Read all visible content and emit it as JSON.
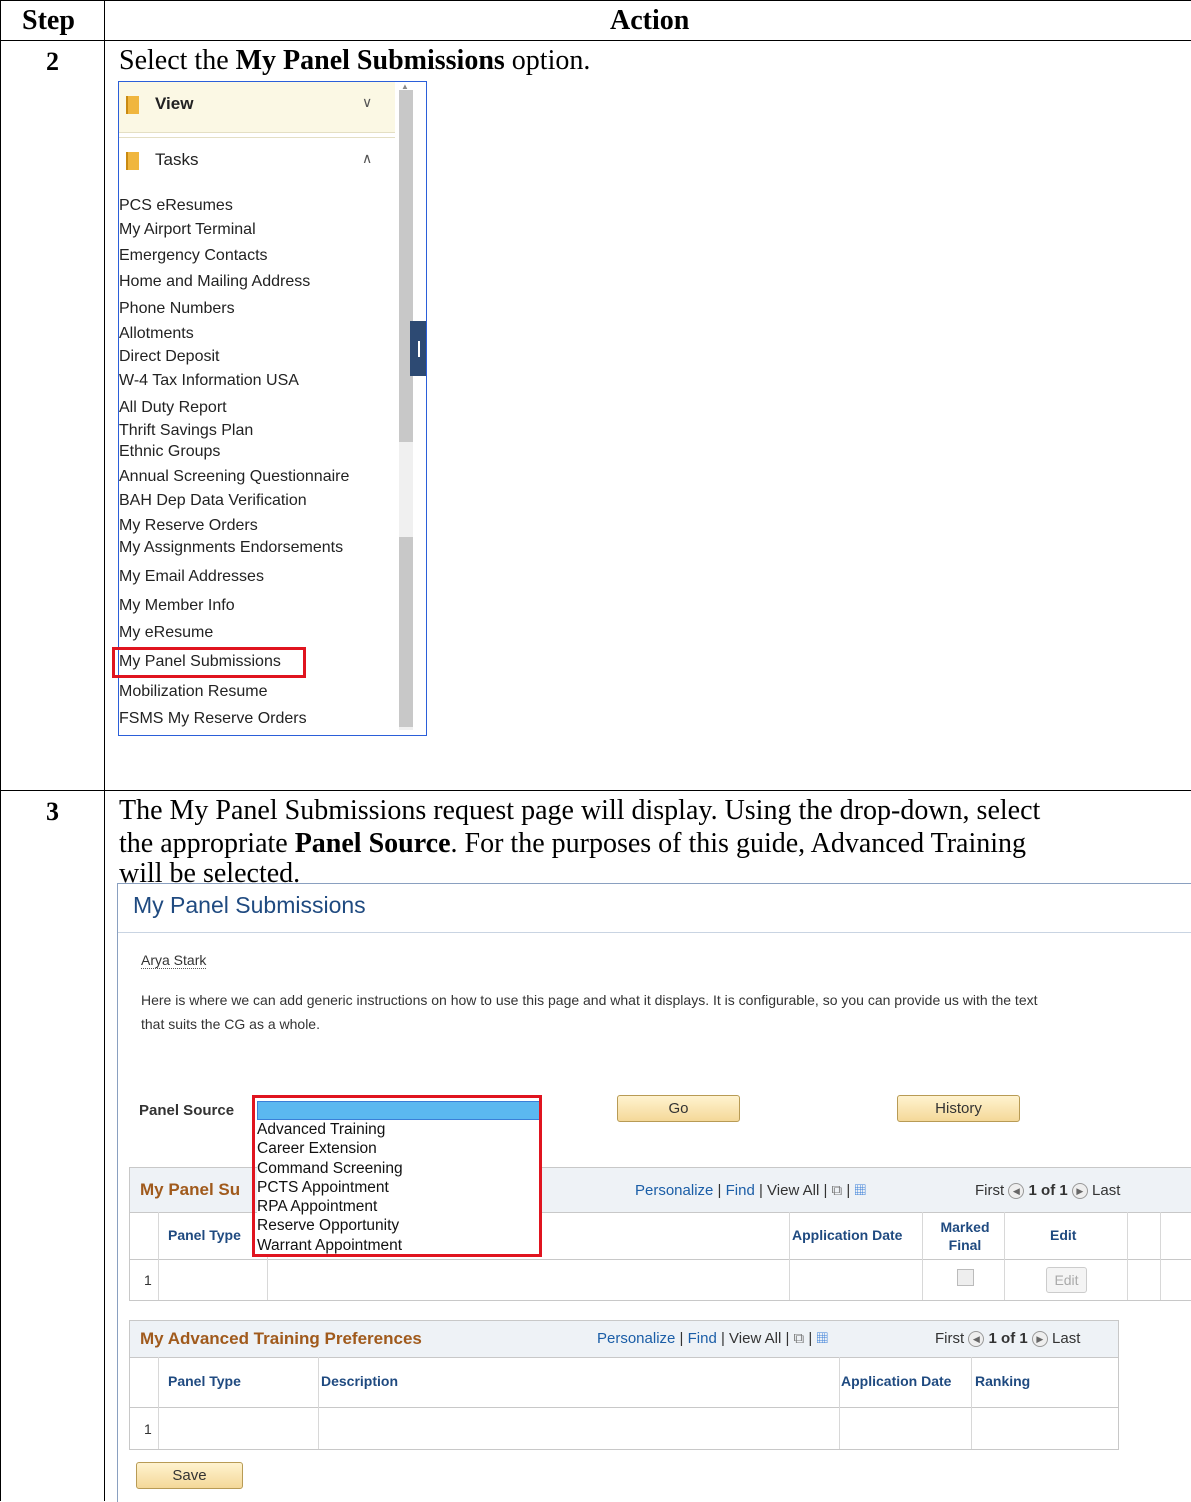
{
  "table": {
    "header_step": "Step",
    "header_action": "Action"
  },
  "row2": {
    "step": "2",
    "text_before": "Select the ",
    "text_bold": "My Panel Submissions",
    "text_after": " option."
  },
  "nav": {
    "sections": [
      "View",
      "Tasks"
    ],
    "items": [
      "PCS eResumes",
      "My Airport Terminal",
      "Emergency Contacts",
      "Home and Mailing Address",
      "Phone Numbers",
      "Allotments",
      "Direct Deposit",
      "W-4 Tax Information USA",
      "All Duty Report",
      "Thrift Savings Plan",
      "Ethnic Groups",
      "Annual Screening Questionnaire",
      "BAH Dep Data Verification",
      "My Reserve Orders",
      "My Assignments Endorsements",
      "My Email Addresses",
      "My Member Info",
      "My eResume",
      "My Panel Submissions",
      "Mobilization Resume",
      "FSMS My Reserve Orders"
    ]
  },
  "row3": {
    "step": "3",
    "line1": "The My Panel Submissions request page will display.  Using the drop-down, select",
    "line2_before": "the appropriate ",
    "line2_bold": "Panel Source",
    "line2_after": ".  For the purposes of this guide, Advanced Training",
    "line3": "will be selected."
  },
  "panel": {
    "title": "My Panel Submissions",
    "user_name": "Arya Stark",
    "instructions": "Here is where we can add generic instructions on how to use this page and what it displays. It is configurable, so you can provide us with the text that suits the CG as a whole.",
    "panel_source_label": "Panel Source",
    "go_label": "Go",
    "history_label": "History",
    "save_label": "Save",
    "dropdown_options": [
      "Advanced Training",
      "Career Extension",
      "Command Screening",
      "PCTS Appointment",
      "RPA Appointment",
      "Reserve Opportunity",
      "Warrant Appointment"
    ],
    "grid1": {
      "title": "My Panel Su",
      "personalize": "Personalize",
      "find": "Find",
      "view_all": "View All",
      "first": "First",
      "pager": "1 of 1",
      "last": "Last",
      "col_panel_type": "Panel Type",
      "col_application_date": "Application Date",
      "col_marked_final": "Marked Final",
      "col_edit": "Edit",
      "row_number": "1",
      "edit_button": "Edit"
    },
    "grid2": {
      "title": "My Advanced Training Preferences",
      "personalize": "Personalize",
      "find": "Find",
      "view_all": "View All",
      "first": "First",
      "pager": "1 of 1",
      "last": "Last",
      "col_panel_type": "Panel Type",
      "col_description": "Description",
      "col_application_date": "Application Date",
      "col_ranking": "Ranking",
      "row_number": "1"
    }
  }
}
